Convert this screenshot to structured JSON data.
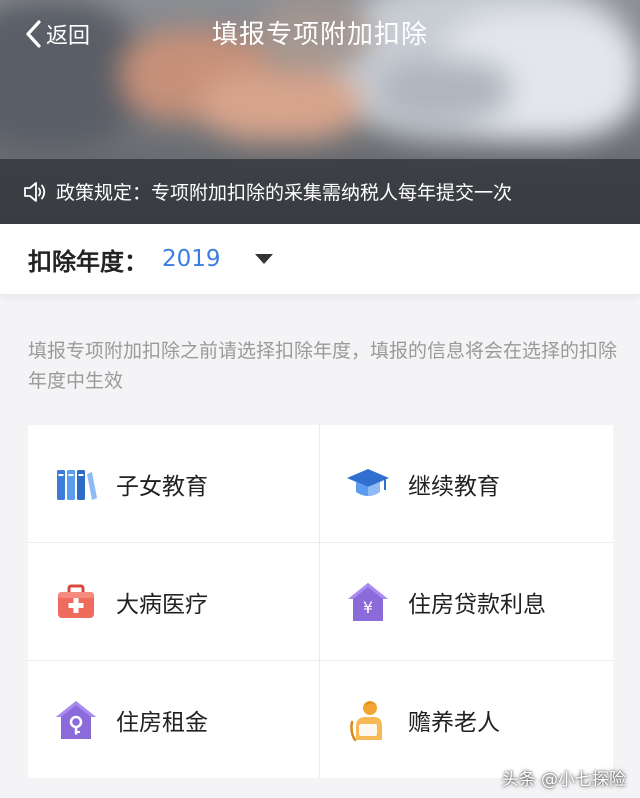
{
  "nav": {
    "back_label": "返回",
    "title": "填报专项附加扣除"
  },
  "notice": {
    "icon": "speaker-icon",
    "text": "政策规定：专项附加扣除的采集需纳税人每年提交一次"
  },
  "year_selector": {
    "label": "扣除年度：",
    "value": "2019"
  },
  "hint": "填报专项附加扣除之前请选择扣除年度，填报的信息将会在选择的扣除年度中生效",
  "categories": [
    {
      "label": "子女教育",
      "icon": "books-icon",
      "color": "#3d7cd9"
    },
    {
      "label": "继续教育",
      "icon": "graduation-cap-icon",
      "color": "#2f6fd0"
    },
    {
      "label": "大病医疗",
      "icon": "medical-kit-icon",
      "color": "#ef6b5e"
    },
    {
      "label": "住房贷款利息",
      "icon": "house-yen-icon",
      "color": "#8b6bd9"
    },
    {
      "label": "住房租金",
      "icon": "house-key-icon",
      "color": "#8b6bd9"
    },
    {
      "label": "赡养老人",
      "icon": "elder-icon",
      "color": "#f2a531"
    }
  ],
  "watermark": "头条 @小七探险",
  "colors": {
    "accent": "#3b7de0",
    "hint_text": "#9a9a9a",
    "notice_bg": "#2c2f35"
  }
}
